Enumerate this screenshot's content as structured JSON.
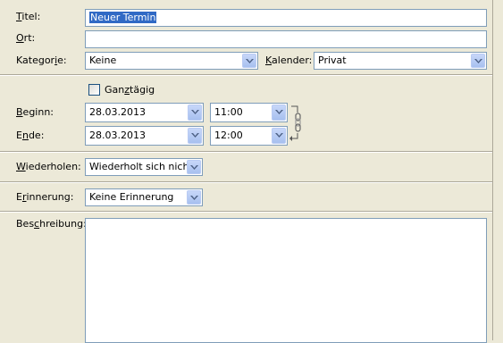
{
  "title": {
    "label_pre": "",
    "label_u": "T",
    "label_post": "itel:",
    "value": "Neuer Termin"
  },
  "location": {
    "label_pre": "",
    "label_u": "O",
    "label_post": "rt:",
    "value": ""
  },
  "category": {
    "label_pre": "Kategor",
    "label_u": "i",
    "label_post": "e:",
    "value": "Keine"
  },
  "calendar": {
    "label_pre": "",
    "label_u": "K",
    "label_post": "alender:",
    "value": "Privat"
  },
  "allday": {
    "label_pre": "Gan",
    "label_u": "z",
    "label_post": "tägig",
    "checked": false
  },
  "start": {
    "label_pre": "",
    "label_u": "B",
    "label_post": "eginn:",
    "date": "28.03.2013",
    "time": "11:00"
  },
  "end": {
    "label_pre": "E",
    "label_u": "n",
    "label_post": "de:",
    "date": "28.03.2013",
    "time": "12:00"
  },
  "repeat": {
    "label_pre": "",
    "label_u": "W",
    "label_post": "iederholen:",
    "value": "Wiederholt sich nicht"
  },
  "reminder": {
    "label_pre": "E",
    "label_u": "r",
    "label_post": "innerung:",
    "value": "Keine Erinnerung"
  },
  "description": {
    "label_pre": "Bes",
    "label_u": "c",
    "label_post": "hreibung:",
    "value": ""
  },
  "icons": {
    "dropdown": "chevron-down-icon",
    "link": "chain-link-icon"
  },
  "colors": {
    "background": "#ece9d8",
    "field_border": "#7f9db9",
    "selection": "#316ac5"
  }
}
